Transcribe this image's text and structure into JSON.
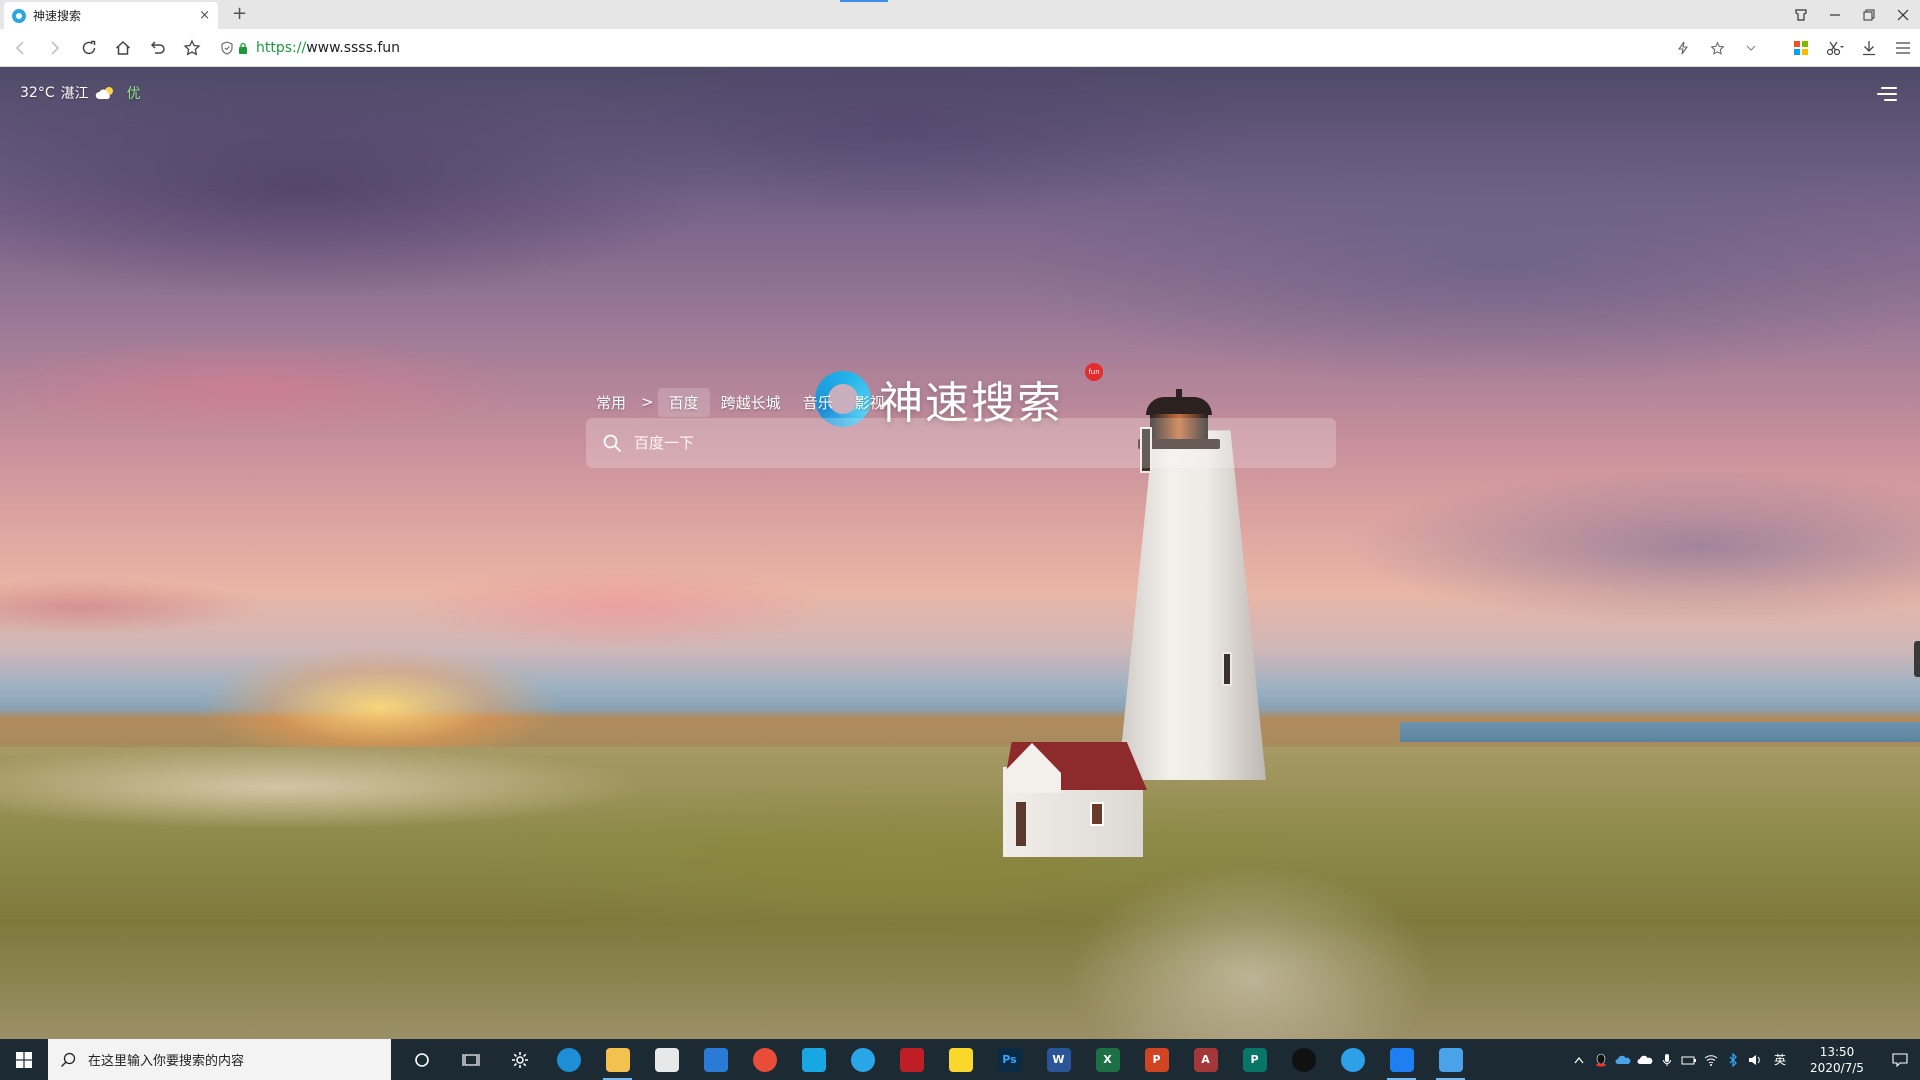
{
  "browser": {
    "tab": {
      "title": "神速搜索",
      "close": "×"
    },
    "new_tab": "+",
    "address": {
      "scheme": "https://",
      "host": "www.ssss.fun"
    }
  },
  "page": {
    "weather": {
      "temp": "32°C",
      "city": "湛江",
      "aqi": "优"
    },
    "logo_text": "神速搜索",
    "logo_badge": "fun",
    "engines": {
      "category": "常用",
      "chevron": ">",
      "items": [
        "百度",
        "跨越长城",
        "音乐",
        "影视"
      ],
      "active_index": 0
    },
    "search": {
      "placeholder": "百度一下"
    }
  },
  "taskbar": {
    "search_placeholder": "在这里输入你要搜索的内容",
    "apps": [
      {
        "name": "cortana-icon",
        "color": "transparent",
        "label": ""
      },
      {
        "name": "task-view-icon",
        "color": "transparent",
        "label": ""
      },
      {
        "name": "settings-icon",
        "color": "transparent",
        "label": ""
      },
      {
        "name": "edge-icon",
        "color": "#1e8fd6",
        "label": ""
      },
      {
        "name": "file-explorer-icon",
        "color": "#f2c14e",
        "label": ""
      },
      {
        "name": "store-icon",
        "color": "#e8e8e8",
        "label": ""
      },
      {
        "name": "mail-icon",
        "color": "#2a7bd6",
        "label": ""
      },
      {
        "name": "chrome-icon",
        "color": "#e94d3a",
        "label": ""
      },
      {
        "name": "skype-icon",
        "color": "#17a7e5",
        "label": ""
      },
      {
        "name": "browser-fish-icon",
        "color": "#29a6e8",
        "label": ""
      },
      {
        "name": "filezilla-icon",
        "color": "#bf1e24",
        "label": ""
      },
      {
        "name": "sticky-notes-icon",
        "color": "#f9d72b",
        "label": ""
      },
      {
        "name": "photoshop-icon",
        "color": "#0b2a44",
        "label": "Ps"
      },
      {
        "name": "word-icon",
        "color": "#2a5699",
        "label": "W"
      },
      {
        "name": "excel-icon",
        "color": "#1d7044",
        "label": "X"
      },
      {
        "name": "powerpoint-icon",
        "color": "#d04423",
        "label": "P"
      },
      {
        "name": "access-icon",
        "color": "#a4373a",
        "label": "A"
      },
      {
        "name": "publisher-icon",
        "color": "#077568",
        "label": "P"
      },
      {
        "name": "qq-icon",
        "color": "#111",
        "label": ""
      },
      {
        "name": "feishu-icon",
        "color": "#2da0e8",
        "label": ""
      },
      {
        "name": "lanhu-icon",
        "color": "#1d7ff2",
        "label": ""
      },
      {
        "name": "photos-icon",
        "color": "#4aa3e8",
        "label": ""
      }
    ],
    "running_indices": [
      4,
      20,
      21
    ],
    "ime": "英",
    "time": "13:50",
    "date": "2020/7/5"
  }
}
